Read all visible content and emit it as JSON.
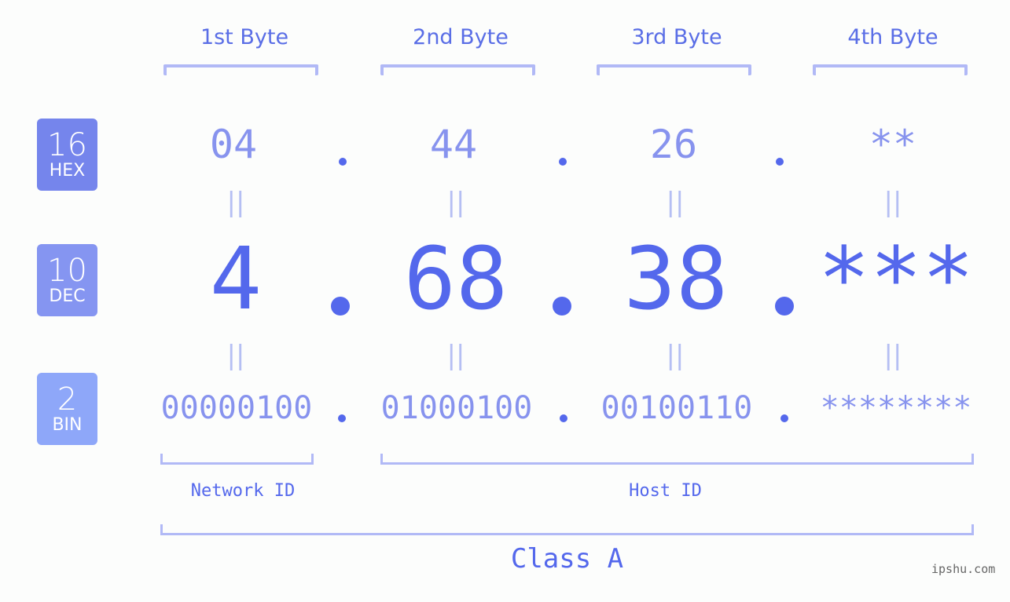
{
  "columns": [
    "1st Byte",
    "2nd Byte",
    "3rd Byte",
    "4th Byte"
  ],
  "badges": {
    "hex": {
      "num": "16",
      "name": "HEX",
      "color": "#7585ec"
    },
    "dec": {
      "num": "10",
      "name": "DEC",
      "color": "#8595f1"
    },
    "bin": {
      "num": "2",
      "name": "BIN",
      "color": "#8ea7f9"
    }
  },
  "hex_values": [
    "04",
    "44",
    "26",
    "**"
  ],
  "dec_values": [
    "4",
    "68",
    "38",
    "***"
  ],
  "bin_values": [
    "00000100",
    "01000100",
    "00100110",
    "********"
  ],
  "equals_symbol": "||",
  "network_label": "Network ID",
  "host_label": "Host ID",
  "class_label": "Class A",
  "watermark": "ipshu.com",
  "colors": {
    "accent": "#5468ec",
    "light": "#8793ee",
    "bracket": "#b1b9f6"
  }
}
